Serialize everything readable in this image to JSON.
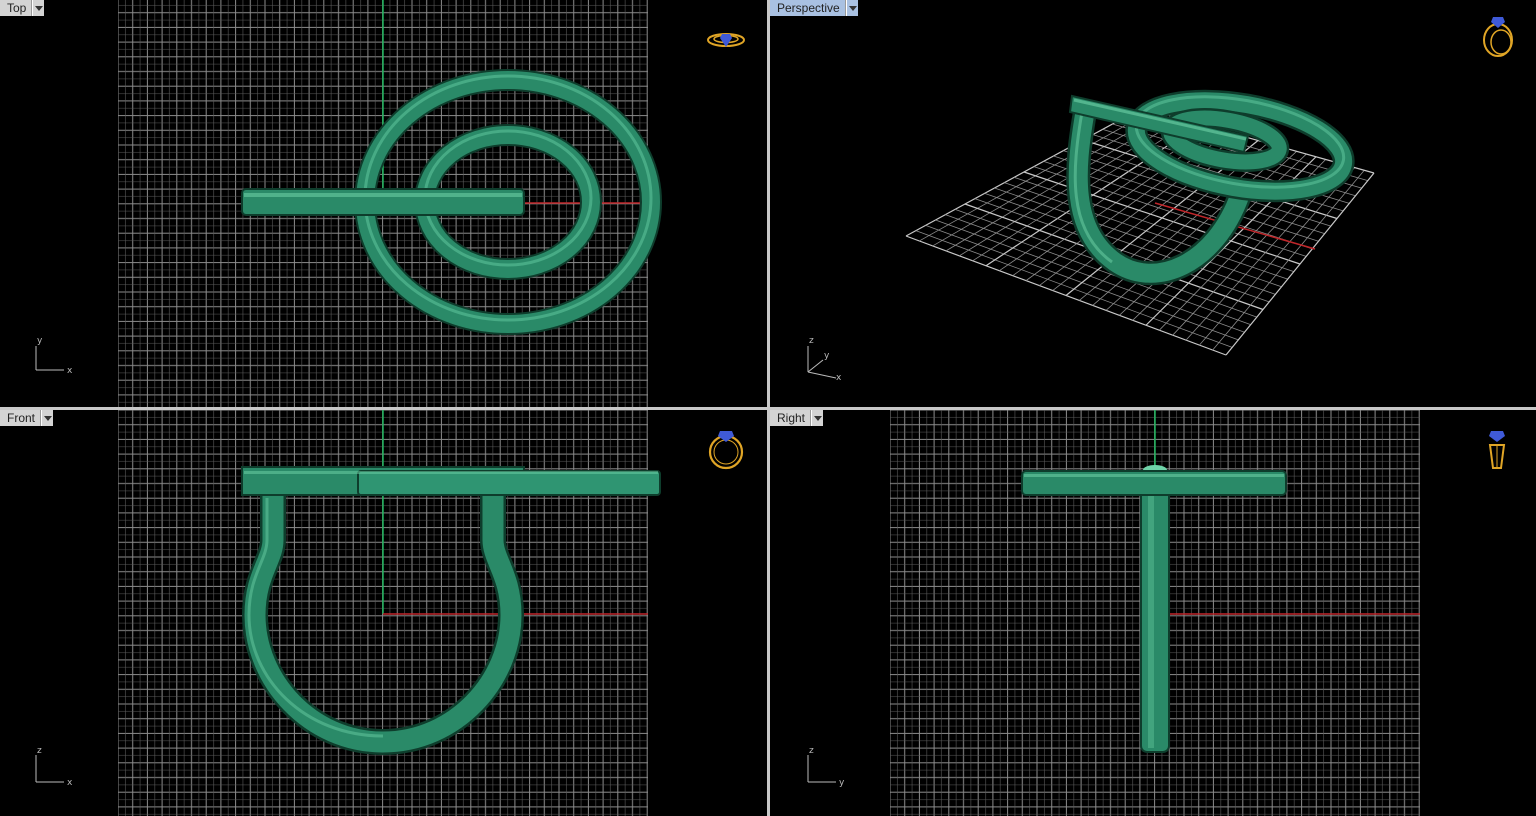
{
  "viewports": {
    "top": {
      "label": "Top",
      "axis_h": "x",
      "axis_v": "y",
      "gumball_icon": "ring-top-icon"
    },
    "perspective": {
      "label": "Perspective",
      "axis_h": "x",
      "axis_v": "y",
      "axis_up": "z",
      "gumball_icon": "ring-perspective-icon"
    },
    "front": {
      "label": "Front",
      "axis_h": "x",
      "axis_v": "z",
      "gumball_icon": "ring-front-icon"
    },
    "right": {
      "label": "Right",
      "axis_h": "y",
      "axis_v": "z",
      "gumball_icon": "ring-right-icon"
    }
  },
  "active_viewport": "perspective",
  "colors": {
    "background": "#000000",
    "grid_line": "#8c8c8c",
    "grid_major": "#c8c8c8",
    "x_axis": "#c0262a",
    "y_axis": "#1cb35a",
    "model_fill": "#2a8a68",
    "model_edge": "#0e3d2c",
    "model_highlight": "#6fd3a8",
    "label_bg": "#d4d4d4",
    "label_active_bg": "#a9c1e2",
    "ring_icon": "#e0a526",
    "gem_icon": "#3f5ad8"
  }
}
